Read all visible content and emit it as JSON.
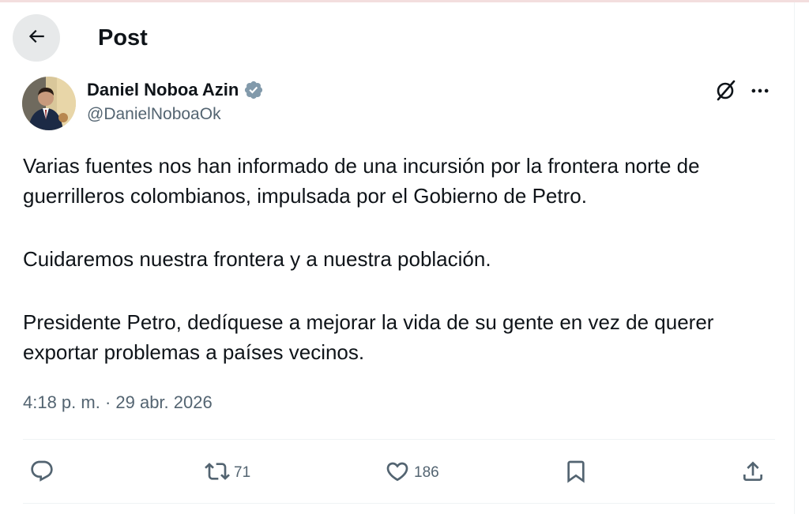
{
  "header": {
    "title": "Post",
    "back_icon": "arrow-left-icon"
  },
  "author": {
    "display_name": "Daniel Noboa Azin",
    "handle": "@DanielNoboaOk",
    "verified_color": "#829aab"
  },
  "tweet": {
    "paragraphs": [
      "Varias fuentes nos han informado de una incursión por la frontera norte de guerrilleros colombianos, impulsada por el Gobierno de Petro.",
      "Cuidaremos nuestra frontera y a nuestra población.",
      "Presidente Petro, dedíquese a mejorar la vida de su gente en vez de querer exportar problemas a países vecinos."
    ],
    "timestamp": "4:18 p. m. · 29 abr. 2026"
  },
  "actions": {
    "reply_count": "",
    "retweet_count": "71",
    "like_count": "186"
  },
  "colors": {
    "text": "#0f1419",
    "secondary": "#536471",
    "divider": "#eff3f4"
  }
}
